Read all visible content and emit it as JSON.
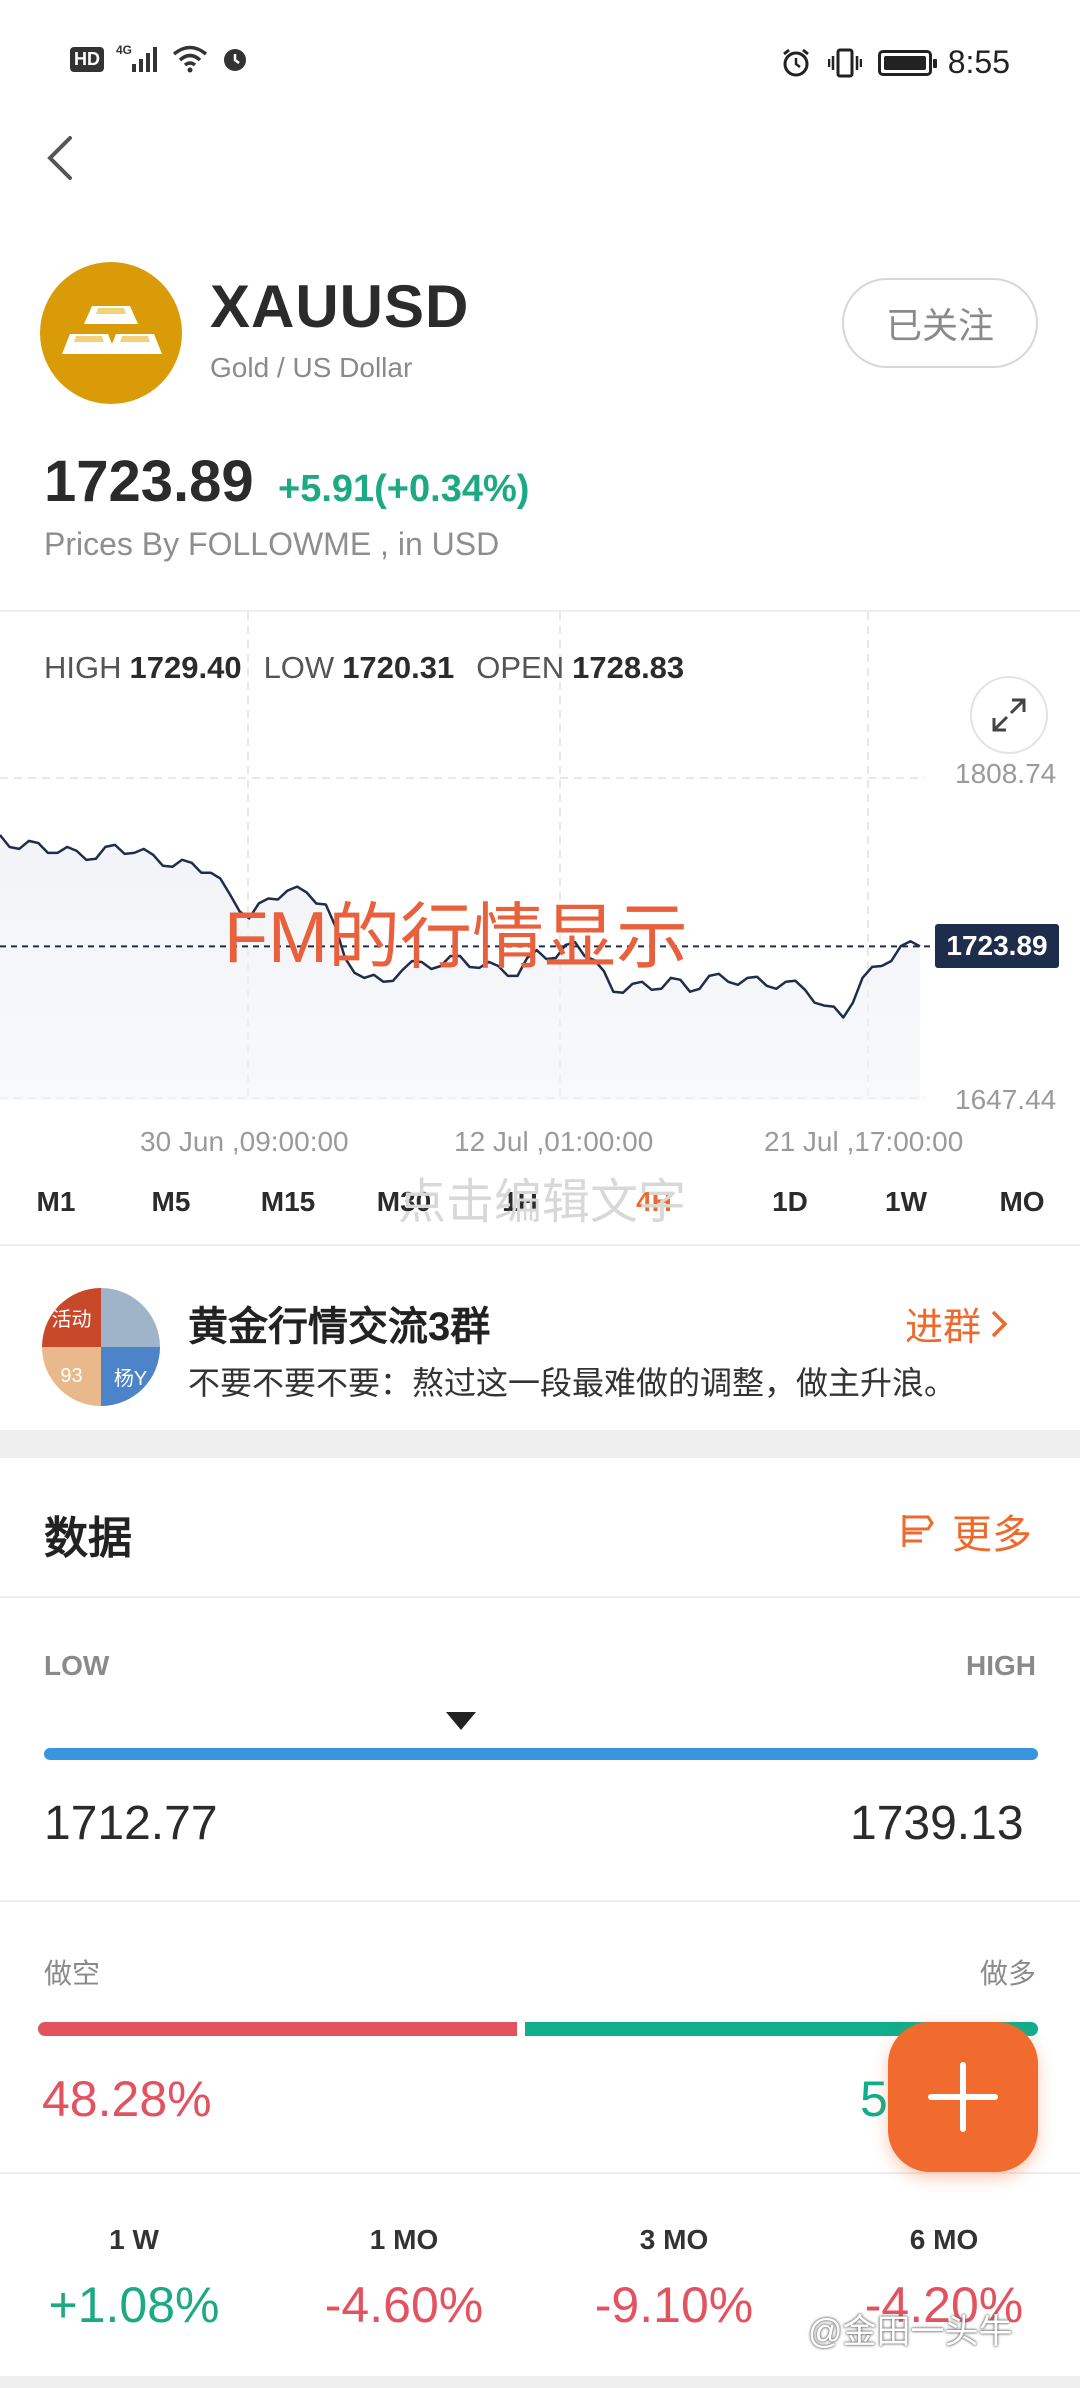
{
  "status_bar": {
    "left": "HD 4G",
    "time": "8:55"
  },
  "header": {
    "symbol": "XAUUSD",
    "subtitle": "Gold / US Dollar",
    "follow_label": "已关注"
  },
  "quote": {
    "price": "1723.89",
    "change": "+5.91(+0.34%)",
    "source": "Prices By FOLLOWME , in USD"
  },
  "chart": {
    "high_label": "HIGH",
    "high": "1729.40",
    "low_label": "LOW",
    "low": "1720.31",
    "open_label": "OPEN",
    "open": "1728.83",
    "y_top": "1808.74",
    "y_bottom": "1647.44",
    "current": "1723.89",
    "x_labels": [
      "30 Jun ,09:00:00",
      "12 Jul ,01:00:00",
      "21 Jul ,17:00:00"
    ],
    "overlay_title": "FM的行情显示",
    "overlay_edit": "点击编辑文字"
  },
  "chart_data": {
    "type": "area",
    "series": [
      {
        "values": [
          1780,
          1773,
          1776,
          1771,
          1772,
          1768,
          1775,
          1771,
          1770,
          1764,
          1766,
          1761,
          1750,
          1738,
          1748,
          1752,
          1751,
          1745,
          1718,
          1708,
          1706,
          1712,
          1716,
          1714,
          1719,
          1713,
          1714,
          1709,
          1722,
          1718,
          1726,
          1717,
          1701,
          1705,
          1702,
          1708,
          1701,
          1709,
          1706,
          1708,
          1704,
          1706,
          1702,
          1694,
          1688,
          1708,
          1714,
          1724,
          1723.89
        ]
      }
    ],
    "ylim": [
      1647.44,
      1808.74
    ],
    "grid": true
  },
  "timeframes": {
    "items": [
      "M1",
      "M5",
      "M15",
      "M30",
      "1H",
      "4H",
      "1D",
      "1W",
      "MO"
    ],
    "active": "4H"
  },
  "group": {
    "title": "黄金行情交流3群",
    "message": "不要不要不要：熬过这一段最难做的调整，做主升浪。",
    "join_label": "进群",
    "avatar_tiles": [
      "活动",
      "",
      "93",
      "杨Y"
    ]
  },
  "data_section": {
    "title": "数据",
    "more_label": "更多",
    "low_label": "LOW",
    "high_label": "HIGH",
    "range_low": "1712.77",
    "range_high": "1739.13",
    "marker_fraction": 0.42,
    "short_label": "做空",
    "long_label": "做多",
    "short_pct": "48.28%",
    "long_pct": "5",
    "short_fraction": 0.4828
  },
  "performance": [
    {
      "label": "1 W",
      "value": "+1.08%",
      "dir": "pos"
    },
    {
      "label": "1 MO",
      "value": "-4.60%",
      "dir": "neg"
    },
    {
      "label": "3 MO",
      "value": "-9.10%",
      "dir": "neg"
    },
    {
      "label": "6 MO",
      "value": "-4.20%",
      "dir": "neg"
    }
  ],
  "credit": "@金田一头牛",
  "colors": {
    "accent": "#ee6a2c",
    "up": "#1daa82",
    "down": "#e2525f",
    "range": "#3796dd",
    "logo": "#d99b08"
  }
}
